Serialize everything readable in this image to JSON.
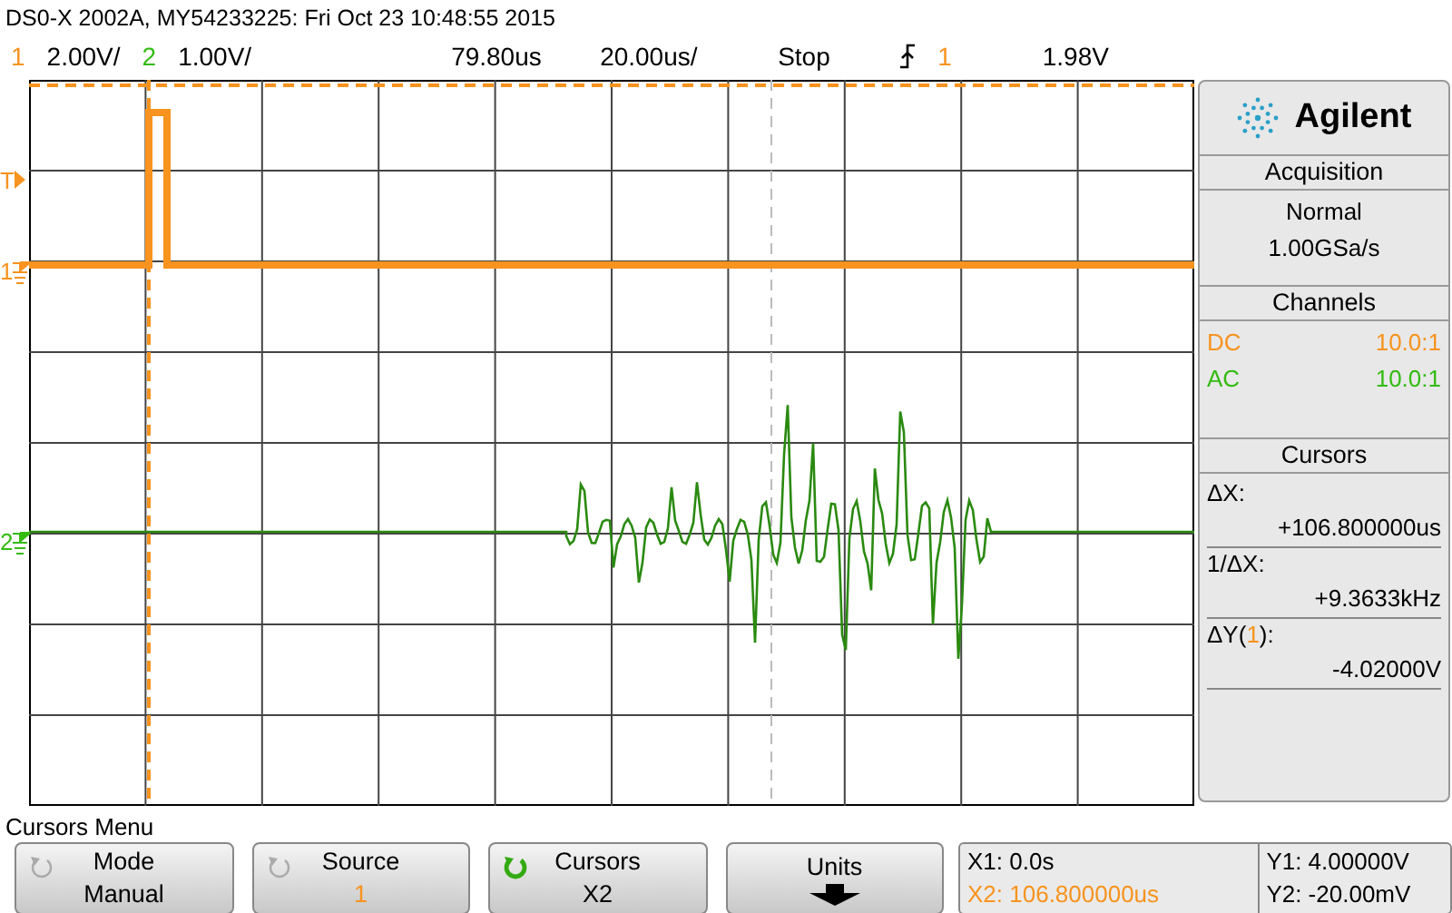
{
  "header": {
    "title": "DS0-X 2002A, MY54233225: Fri Oct 23 10:48:55 2015",
    "channels": [
      {
        "number": "1",
        "scale": "2.00V/",
        "color": "#f7931e"
      },
      {
        "number": "2",
        "scale": "1.00V/",
        "color": "#33bb11"
      }
    ],
    "delay": "79.80us",
    "timebase": "20.00us/",
    "run_state": "Stop",
    "trigger_source": "1",
    "trigger_level": "1.98V"
  },
  "graticule": {
    "markers": [
      {
        "label": "T",
        "kind": "trigger"
      },
      {
        "label": "1",
        "kind": "channel"
      },
      {
        "label": "2",
        "kind": "channel"
      }
    ]
  },
  "panel": {
    "brand": "Agilent",
    "acquisition": {
      "title": "Acquisition",
      "mode": "Normal",
      "rate": "1.00GSa/s"
    },
    "channels": {
      "title": "Channels",
      "items": [
        {
          "coupling": "DC",
          "probe": "10.0:1",
          "color": "#f7931e"
        },
        {
          "coupling": "AC",
          "probe": "10.0:1",
          "color": "#33bb11"
        }
      ]
    },
    "cursors": {
      "title": "Cursors",
      "lines": [
        {
          "kind": "label",
          "text": "ΔX:"
        },
        {
          "kind": "value",
          "text": "+106.800000us"
        },
        {
          "kind": "label",
          "text": "1/ΔX:"
        },
        {
          "kind": "value",
          "text": "+9.3633kHz"
        },
        {
          "kind": "label",
          "text": "ΔY(",
          "source": "1",
          "text_end": "):"
        },
        {
          "kind": "value",
          "text": "-4.02000V"
        }
      ]
    }
  },
  "menu": {
    "title": "Cursors Menu",
    "softkeys": [
      {
        "label": "Mode",
        "value": "Manual",
        "kind": "knob",
        "active": false
      },
      {
        "label": "Source",
        "value": "1",
        "kind": "knob",
        "active": false,
        "color": "#f7931e"
      },
      {
        "label": "Cursors",
        "value": "X2",
        "kind": "knob",
        "active": true
      },
      {
        "label": "Units",
        "kind": "arrow"
      }
    ],
    "readout": [
      {
        "text": "X1: 0.0s",
        "selected": false
      },
      {
        "text": "X2: 106.800000us",
        "selected": true
      },
      {
        "text": "Y1: 4.00000V",
        "selected": false
      },
      {
        "text": "Y2: -20.00mV",
        "selected": false
      }
    ]
  }
}
